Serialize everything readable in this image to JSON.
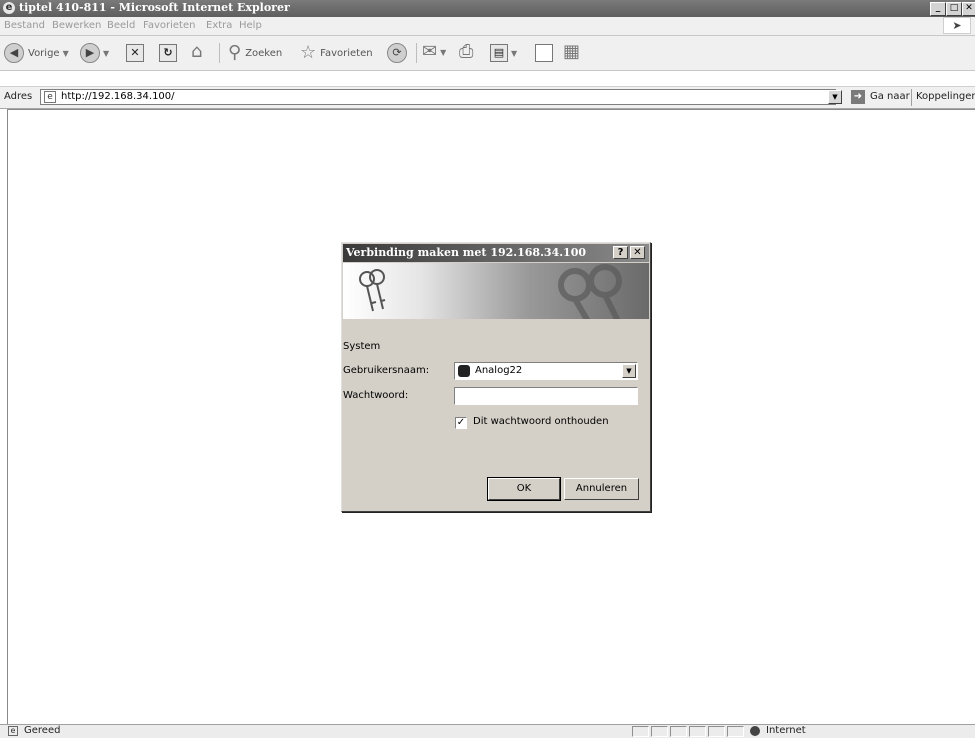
{
  "window": {
    "title": "tiptel 410-811 - Microsoft Internet Explorer",
    "icon": "ie-page-icon",
    "controls": {
      "minimize": "_",
      "maximize": "□",
      "close": "✕"
    }
  },
  "menu": {
    "items": [
      "Bestand",
      "Bewerken",
      "Beeld",
      "Favorieten",
      "Extra",
      "Help"
    ]
  },
  "toolbar": {
    "back_label": "Vorige",
    "search_label": "Zoeken",
    "favorites_label": "Favorieten",
    "icons": [
      "back-icon",
      "forward-icon",
      "stop-icon",
      "refresh-icon",
      "home-icon",
      "search-icon",
      "favorites-icon",
      "history-icon",
      "mail-icon",
      "print-icon",
      "edit-icon",
      "discuss-icon",
      "messenger-icon"
    ]
  },
  "address": {
    "label": "Adres",
    "url": "http://192.168.34.100/",
    "go_label": "Ga naar",
    "links_label": "Koppelingen"
  },
  "dialog": {
    "title": "Verbinding maken met 192.168.34.100",
    "help_btn": "?",
    "close_btn": "✕",
    "realm": "System",
    "username_label": "Gebruikersnaam:",
    "username_value": "Analog22",
    "password_label": "Wachtwoord:",
    "password_value": "",
    "remember_label": "Dit wachtwoord onthouden",
    "remember_checked": true,
    "ok_label": "OK",
    "cancel_label": "Annuleren"
  },
  "status": {
    "text": "Gereed",
    "zone": "Internet"
  }
}
